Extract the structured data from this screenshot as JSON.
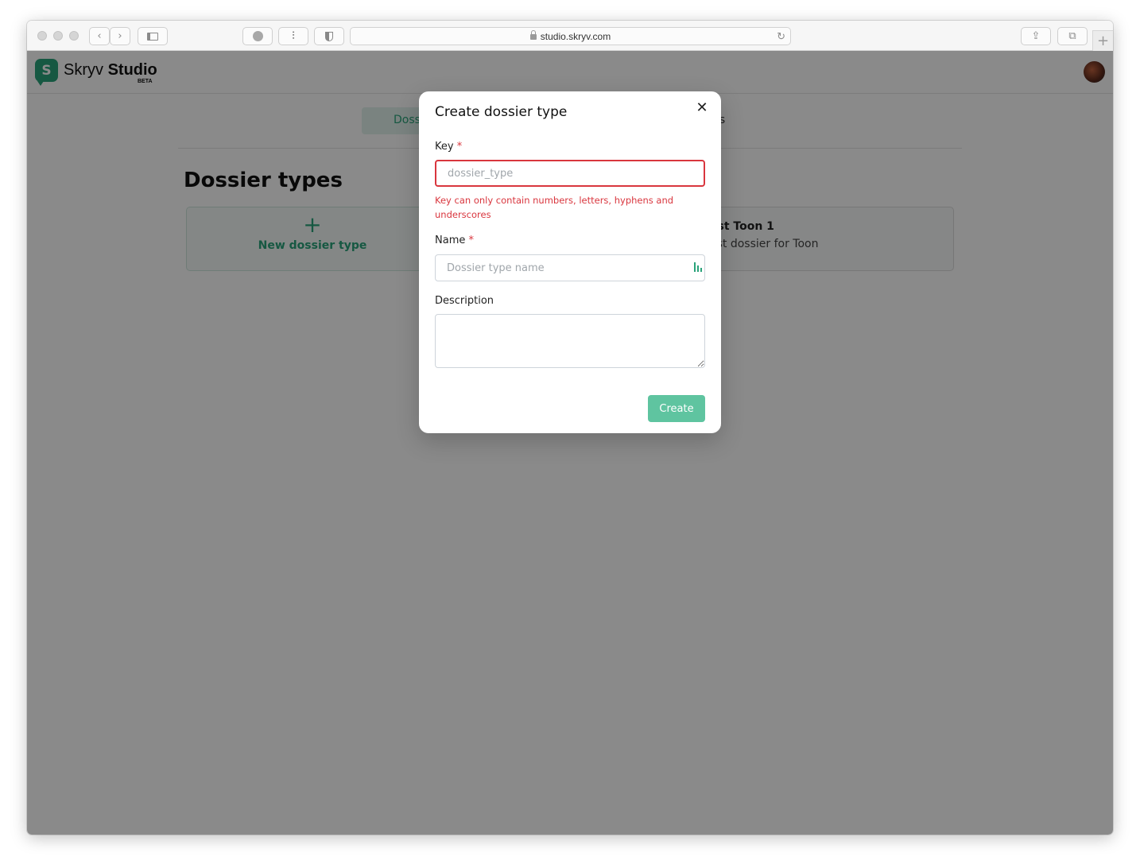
{
  "browser": {
    "url": "studio.skryv.com"
  },
  "app": {
    "brand_light": "Skryv",
    "brand_bold": "Studio",
    "beta_label": "BETA",
    "accent_color": "#2aa37a"
  },
  "nav": {
    "active_tab_partial": "Doss",
    "other_tab_partial": "gs"
  },
  "main": {
    "title": "Dossier types",
    "new_card": {
      "icon": "plus-icon",
      "label": "New dossier type"
    },
    "dossier_card": {
      "name_partial": "est Toon 1",
      "description_partial": "est dossier for Toon"
    }
  },
  "modal": {
    "title": "Create dossier type",
    "close_icon": "close-icon",
    "key": {
      "label": "Key",
      "required_mark": "*",
      "placeholder": "dossier_type",
      "value": "",
      "error": "Key can only contain numbers, letters, hyphens and underscores"
    },
    "name": {
      "label": "Name",
      "required_mark": "*",
      "placeholder": "Dossier type name",
      "value": ""
    },
    "description": {
      "label": "Description",
      "value": ""
    },
    "submit_label": "Create"
  }
}
